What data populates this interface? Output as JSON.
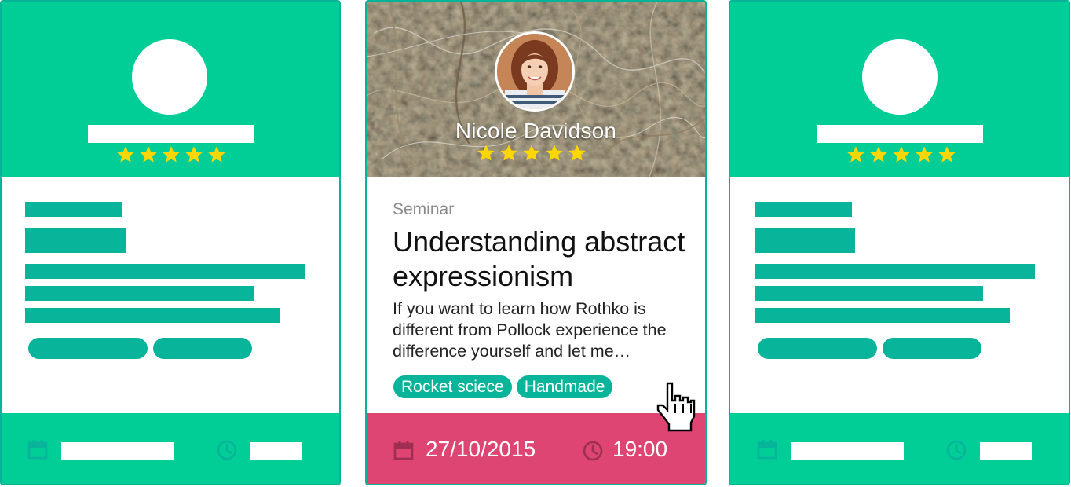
{
  "cards": {
    "featured": {
      "presenter_name": "Nicole Davidson",
      "rating": 5,
      "category": "Seminar",
      "title": "Understanding abstract expressionism",
      "description": "If you want to learn how Rothko is different from Pollock experience the difference yourself and let me…",
      "tags": [
        "Rocket sciece",
        "Handmade"
      ],
      "date": "27/10/2015",
      "time": "19:00"
    },
    "placeholder_left": {
      "rating": 5
    },
    "placeholder_right": {
      "rating": 5
    }
  },
  "colors": {
    "header_green": "#01cd96",
    "bar_teal": "#08b49a",
    "footer_pink": "#df4573",
    "star_yellow": "#ffd600"
  },
  "icons": [
    "star-icon",
    "calendar-icon",
    "clock-icon",
    "hand-cursor-icon"
  ]
}
